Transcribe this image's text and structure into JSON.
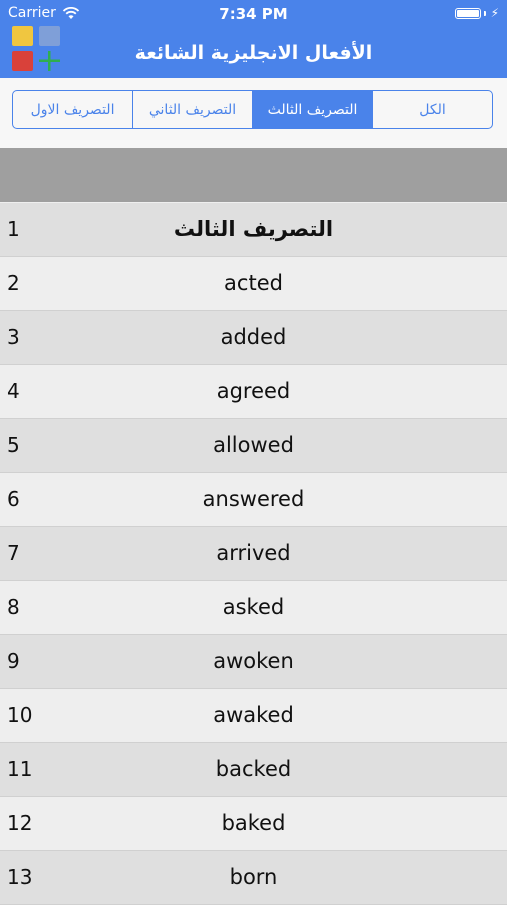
{
  "status_bar": {
    "carrier": "Carrier",
    "time": "7:34 PM",
    "battery_level": 1.0
  },
  "header": {
    "title": "الأفعال الانجليزية الشائعة"
  },
  "colors": {
    "accent": "#4a83ea",
    "logo_yellow": "#f0c640",
    "logo_blue": "#7f9fd8",
    "logo_red": "#d9413a",
    "logo_green": "#2fae4f"
  },
  "tabs": [
    {
      "label": "التصريف الاول",
      "active": false
    },
    {
      "label": "التصريف الثاني",
      "active": false
    },
    {
      "label": "التصريف الثالث",
      "active": true
    },
    {
      "label": "الكل",
      "active": false
    }
  ],
  "list": {
    "rows": [
      {
        "num": "1",
        "word": "التصريف الثالث"
      },
      {
        "num": "2",
        "word": "acted"
      },
      {
        "num": "3",
        "word": "added"
      },
      {
        "num": "4",
        "word": "agreed"
      },
      {
        "num": "5",
        "word": "allowed"
      },
      {
        "num": "6",
        "word": "answered"
      },
      {
        "num": "7",
        "word": "arrived"
      },
      {
        "num": "8",
        "word": "asked"
      },
      {
        "num": "9",
        "word": "awoken"
      },
      {
        "num": "10",
        "word": "awaked"
      },
      {
        "num": "11",
        "word": "backed"
      },
      {
        "num": "12",
        "word": "baked"
      },
      {
        "num": "13",
        "word": "born"
      }
    ]
  }
}
